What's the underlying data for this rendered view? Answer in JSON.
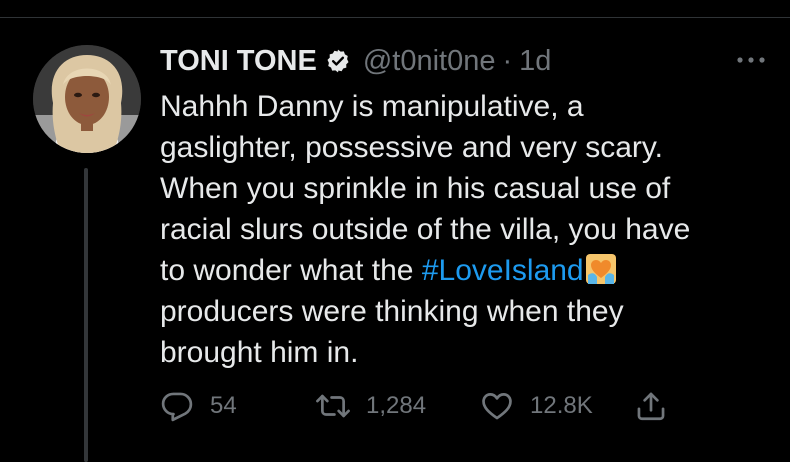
{
  "tweet": {
    "display_name": "TONI TONE",
    "handle": "@t0nit0ne",
    "separator": "·",
    "timestamp": "1d",
    "text_lines": [
      "Nahhh Danny is manipulative, a",
      "gaslighter, possessive and very scary.",
      "When you sprinkle in his casual use of",
      "racial slurs outside of the villa, you have",
      "to wonder what the "
    ],
    "hashtag": "#LoveIsland",
    "text_lines_after": [
      "producers were thinking when they",
      "brought him in."
    ],
    "hashtag_emoji": "heart-hands-emoji",
    "verified": true,
    "avatar": "profile-photo"
  },
  "actions": {
    "reply_count": "54",
    "retweet_count": "1,284",
    "like_count": "12.8K",
    "reply_icon": "reply-icon",
    "retweet_icon": "retweet-icon",
    "like_icon": "heart-icon",
    "share_icon": "share-icon",
    "more_icon": "more-options-icon"
  },
  "colors": {
    "background": "#000000",
    "text": "#e7e9ea",
    "secondary": "#71767b",
    "link": "#1d9bf0",
    "divider": "#2f3336"
  }
}
